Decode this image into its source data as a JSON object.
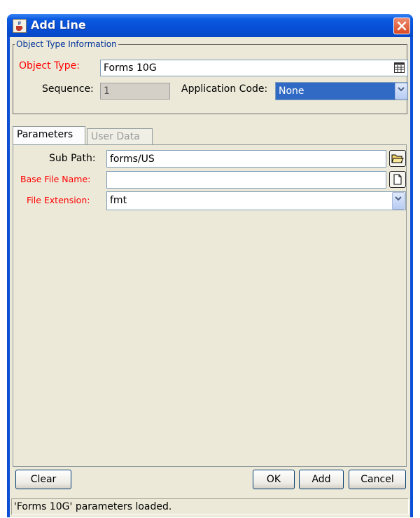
{
  "window": {
    "title": "Add Line"
  },
  "object_type_info": {
    "legend": "Object Type Information",
    "object_type_label": "Object Type:",
    "object_type_value": "Forms 10G",
    "sequence_label": "Sequence:",
    "sequence_value": "1",
    "application_code_label": "Application Code:",
    "application_code_value": "None"
  },
  "tabs": [
    {
      "label": "Parameters"
    },
    {
      "label": "User Data"
    }
  ],
  "parameters": {
    "sub_path_label": "Sub Path:",
    "sub_path_value": "forms/US",
    "base_file_name_label": "Base File Name:",
    "base_file_name_value": "",
    "file_extension_label": "File Extension:",
    "file_extension_value": "fmt"
  },
  "buttons": {
    "clear": "Clear",
    "ok": "OK",
    "add": "Add",
    "cancel": "Cancel"
  },
  "status": {
    "text": "'Forms 10G' parameters loaded."
  },
  "icons": {
    "app": "java-cup-icon",
    "close": "close-icon",
    "lookup": "grid-lookup-icon",
    "folder": "open-folder-icon",
    "file": "new-file-icon",
    "dropdown": "chevron-down-icon"
  },
  "colors": {
    "title_bar": "#0750d8",
    "required_label": "#ff0000",
    "selection": "#316ac5",
    "dialog_bg": "#ece9d8"
  }
}
